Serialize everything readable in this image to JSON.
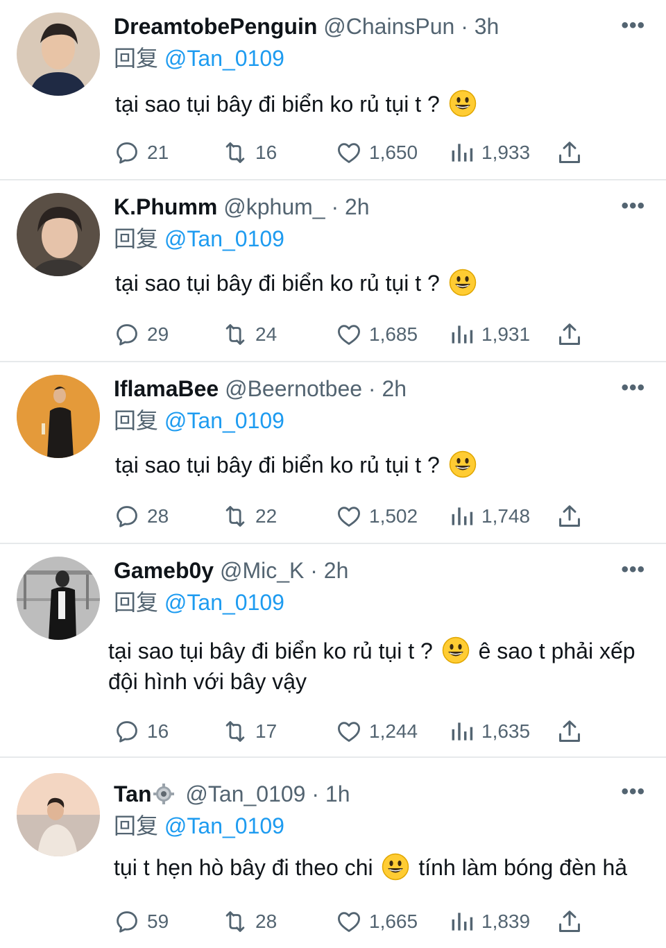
{
  "colors": {
    "accent": "#1d9bf0",
    "secondary_text": "#536471",
    "divider": "#e6e9eb"
  },
  "reply_word": "回复",
  "more_label": "•••",
  "icons": [
    "reply-icon",
    "retweet-icon",
    "heart-icon",
    "views-icon",
    "share-icon",
    "more-icon",
    "settings-gear-icon"
  ],
  "tweets": [
    {
      "name": "DreamtobePenguin",
      "handle": "@ChainsPun",
      "dot": "·",
      "time": "3h",
      "replying_to": "@Tan_0109",
      "text_before": "tại sao tụi bây đi biển ko rủ tụi t ?",
      "text_after": "",
      "replies": "21",
      "retweets": "16",
      "likes": "1,650",
      "views": "1,933"
    },
    {
      "name": "K.Phumm",
      "handle": "@kphum_",
      "dot": "·",
      "time": "2h",
      "replying_to": "@Tan_0109",
      "text_before": "tại sao tụi bây đi biển ko rủ tụi t ?",
      "text_after": "",
      "replies": "29",
      "retweets": "24",
      "likes": "1,685",
      "views": "1,931"
    },
    {
      "name": "IflamaBee",
      "handle": "@Beernotbee",
      "dot": "·",
      "time": "2h",
      "replying_to": "@Tan_0109",
      "text_before": "tại sao tụi bây đi biển ko rủ tụi t ?",
      "text_after": "",
      "replies": "28",
      "retweets": "22",
      "likes": "1,502",
      "views": "1,748"
    },
    {
      "name": "Gameb0y",
      "handle": "@Mic_K",
      "dot": "·",
      "time": "2h",
      "replying_to": "@Tan_0109",
      "text_before": "tại sao tụi bây đi biển ko rủ tụi t ?",
      "text_after": "ê sao t phải xếp đội hình với bây vậy",
      "replies": "16",
      "retweets": "17",
      "likes": "1,244",
      "views": "1,635"
    },
    {
      "name": "Tan",
      "handle": "@Tan_0109",
      "dot": "·",
      "time": "1h",
      "replying_to": "@Tan_0109",
      "text_before": "tụi t hẹn hò bây đi theo chi",
      "text_after": "tính làm bóng đèn hả",
      "replies": "59",
      "retweets": "28",
      "likes": "1,665",
      "views": "1,839"
    }
  ]
}
